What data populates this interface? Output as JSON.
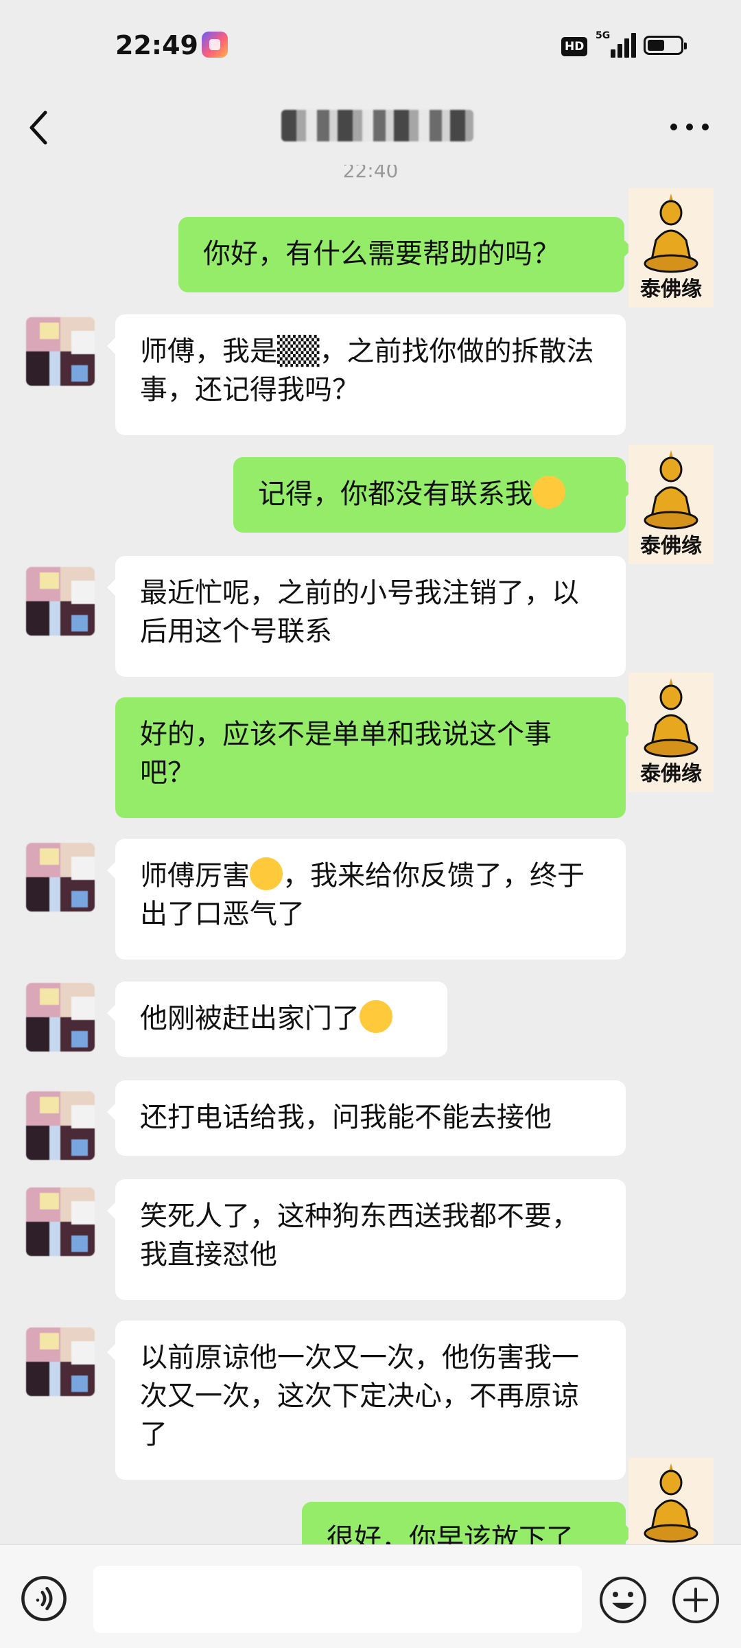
{
  "status_bar": {
    "time": "22:49",
    "network": "5G",
    "hd": "HD"
  },
  "nav": {
    "title": ""
  },
  "chat": {
    "timestamp": "22:40",
    "brand_label": "泰佛缘",
    "messages": [
      {
        "side": "out",
        "text": "你好，有什么需要帮助的吗？"
      },
      {
        "side": "in",
        "text": "师傅，我是▒▒，之前找你做的拆散法事，还记得我吗？"
      },
      {
        "side": "out",
        "text": "记得，你都没有联系我",
        "emoji": "laugh-cry-emoji"
      },
      {
        "side": "in",
        "text": "最近忙呢，之前的小号我注销了，以后用这个号联系"
      },
      {
        "side": "out",
        "text": "好的，应该不是单单和我说这个事吧？"
      },
      {
        "side": "in",
        "text": "师傅厉害",
        "emoji": "thumbs-up-emoji",
        "text2": "，我来给你反馈了，终于出了口恶气了"
      },
      {
        "side": "in",
        "text": "他刚被赶出家门了",
        "emoji": "hand-over-mouth-emoji"
      },
      {
        "side": "in",
        "text": "还打电话给我，问我能不能去接他"
      },
      {
        "side": "in",
        "text": "笑死人了，这种狗东西送我都不要，我直接怼他"
      },
      {
        "side": "in",
        "text": "以前原谅他一次又一次，他伤害我一次又一次，这次下定决心，不再原谅了"
      },
      {
        "side": "out",
        "text": "很好，你早该放下了"
      }
    ]
  },
  "input": {
    "placeholder": ""
  },
  "colors": {
    "out_bubble": "#95ec69",
    "in_bubble": "#ffffff",
    "background": "#ededed"
  }
}
